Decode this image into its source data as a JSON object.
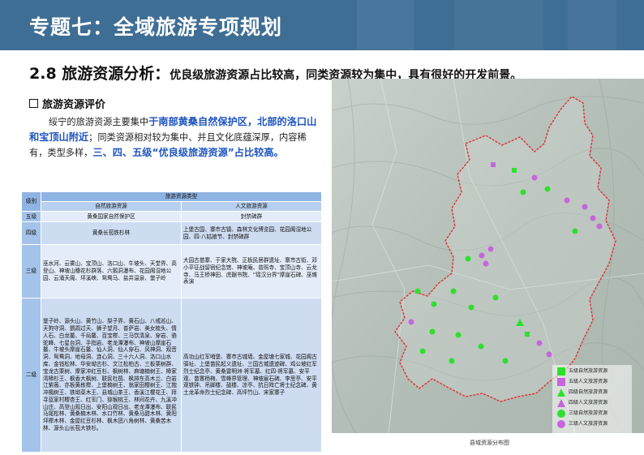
{
  "header": {
    "title": "专题七：全域旅游专项规划"
  },
  "subheading": {
    "number_title": "2.8 旅游资源分析：",
    "summary": "优良级旅游资源占比较高，同类资源较为集中，具有很好的开发前景。"
  },
  "section": {
    "title": "旅游资源评价"
  },
  "paragraph": {
    "p1": "绥宁的旅游资源主要集中",
    "h1": "于南部黄桑自然保护区，北部的洛口山和宝顶山附近",
    "p2": "；同类资源相对较为集中、并且文化底蕴深厚，内容稀有，类型多样，",
    "h2": "三、四、五级“优良级旅游资源”占比较高。"
  },
  "table": {
    "col_level": "级别",
    "col_type": "旅游资源类型",
    "col_natural": "自然旅游资源",
    "col_cultural": "人文旅游资源",
    "rows": [
      {
        "level": "五级",
        "natural": "黄桑国家自然保护区",
        "cultural": "封禁碑群"
      },
      {
        "level": "四级",
        "natural": "黄桑长苞铁杉林",
        "cultural": "上堡古国、寨市古镇、森林文化博览园、花园阁湿地公园、四·八姑娘节、封禁碑群"
      },
      {
        "level": "三级",
        "natural": "巫水河、云雾山、宝顶山、洛口山、牛坡头、天堂界、高登山、神坡山穗花杉群落、六鹅洞瀑布、花园阁湿地公园、云涌天阁、坪溪峡、鸳鸯马、盐井温泉、堡子岭",
        "cultural": "大园古苗寨、于家大院、正板民居群遗址、寨市古街、邓小平征战留宿纪念馆、神坡庵、普照寺、宝顶山寺、云龙寺、马王桥神田、虎踞书院、“瑶汉分界”摩崖石碑、巫傩表演"
      },
      {
        "level": "二级",
        "natural": "堡子岭、源头山、黄竹山、梨子界、黄石山、八戒巡山、天狗守洞、鹦鹉过天、狮子望月、普萨岩、美女梳头、情人石、白龙鳌、千局鳌、百宝榉、三马饮清泉、穿岩、骆驼峰、七星台洞、手指岩、老龙潭瀑布、神坡山摩崖石鳌、牛坡头摩崖石鳌、仙人洞、仙人穿石、风神洞、观音洞、鸳鸯洞、地母洞、连心洞、三十六人洞、洛口山水库、金钱松林、华安坳古杉、文江松柏古、三板栗树群、宝龙古栗树、摩家冲红豆杉、枫树林、麻塘楠树王、樟家湾樟杉王、枫香大枫树、联民杜鹃、枫排东高木兰、白岩江紫薇、亦板黄栋榉、上堡楠树王、翁家田樱树王、江抱冲楓树王、铁坳菜木王、县城山茶王、香溪江樱花王、拜寻蓝家村樱杏王、红军门、猕猴桃王、林间花卉、九溪冲山庄、高登山观日出、安阳山观日出、老龙潭瀑布、联民马尾松林、黄桑楠木林、水口竹林、黄桑马甜木林、黄阳坪榉木林、金屋红豆杉林、枫木团八角树林、黄桑苦木林、源头山长苞大铁杉。",
        "cultural": "高功山红军哨堡、寨市古城墙、金屋塘七家城、花园阁古驿址、上堡苗民起义遗址、三国古城遗迹碑、鸡公坡红军烈士纪念亭、黄桑雷明洲·将军墓、红四·将军墓、安平观、苗寨杨梅、雪峰界管理、神坡雇石碑、李思亭、安平观铁钟、吊脚楼、鼓楼、凉亭、抗日阵亡将士纪念碑、黄土龙革命烈士纪念碑、高坪竹山、宋家寨子"
      }
    ]
  },
  "map": {
    "caption": "县域资源分布图",
    "legend": [
      {
        "label": "五级自然旅游资源",
        "icon": "green-square"
      },
      {
        "label": "五级人文旅游资源",
        "icon": "purple-square"
      },
      {
        "label": "四级自然旅游资源",
        "icon": "green-triangle"
      },
      {
        "label": "四级人文旅游资源",
        "icon": "purple-triangle"
      },
      {
        "label": "三级自然旅游资源",
        "icon": "green-circle"
      },
      {
        "label": "三级人文旅游资源",
        "icon": "purple-circle"
      }
    ],
    "colors": {
      "boundary": "#e0303a",
      "natural": "#2ee02e",
      "cultural": "#c566dc",
      "terrain": "#b9c4bd",
      "header": "#3f6e95"
    }
  }
}
